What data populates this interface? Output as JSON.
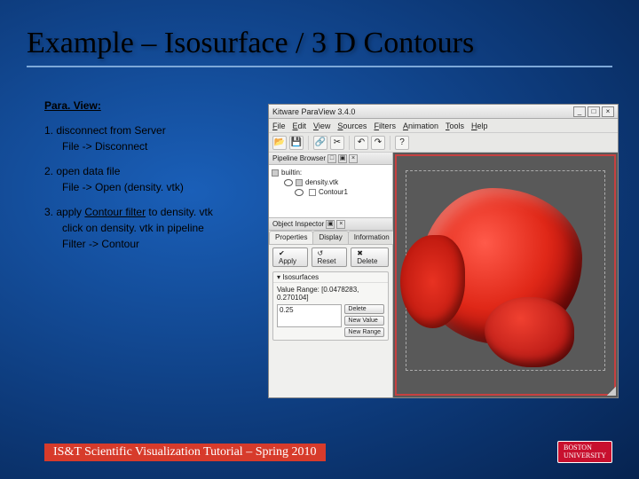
{
  "title": "Example – Isosurface / 3 D Contours",
  "instructions": {
    "heading": "Para. View:",
    "steps": [
      {
        "num": "1. disconnect from Server",
        "sub": [
          "File -> Disconnect"
        ]
      },
      {
        "num": "2. open data file",
        "sub": [
          "File -> Open (density. vtk)"
        ]
      },
      {
        "num": "3. apply Contour filter to density. vtk",
        "sub": [
          "click on density. vtk in pipeline",
          "Filter -> Contour"
        ]
      }
    ]
  },
  "app": {
    "titlebar": "Kitware ParaView 3.4.0",
    "winbtns": [
      "_",
      "□",
      "×"
    ],
    "menubar": [
      "File",
      "Edit",
      "View",
      "Sources",
      "Filters",
      "Animation",
      "Tools",
      "Help"
    ],
    "pipeline": {
      "header": "Pipeline Browser",
      "items": [
        "builtin:",
        "density.vtk",
        "Contour1"
      ]
    },
    "inspector": {
      "header": "Object Inspector",
      "tabs": [
        "Properties",
        "Display",
        "Information"
      ],
      "buttons": {
        "apply": "Apply",
        "reset": "Reset",
        "delete": "Delete"
      },
      "isosurfaces": {
        "label": "Isosurfaces",
        "value_range_label": "Value Range: [0.0478283, 0.270104]",
        "listvalue": "0.25",
        "side": [
          "Delete",
          "New Value",
          "New Range"
        ]
      }
    }
  },
  "footer": "IS&T Scientific Visualization Tutorial – Spring 2010",
  "bu": {
    "line1": "BOSTON",
    "line2": "UNIVERSITY"
  }
}
